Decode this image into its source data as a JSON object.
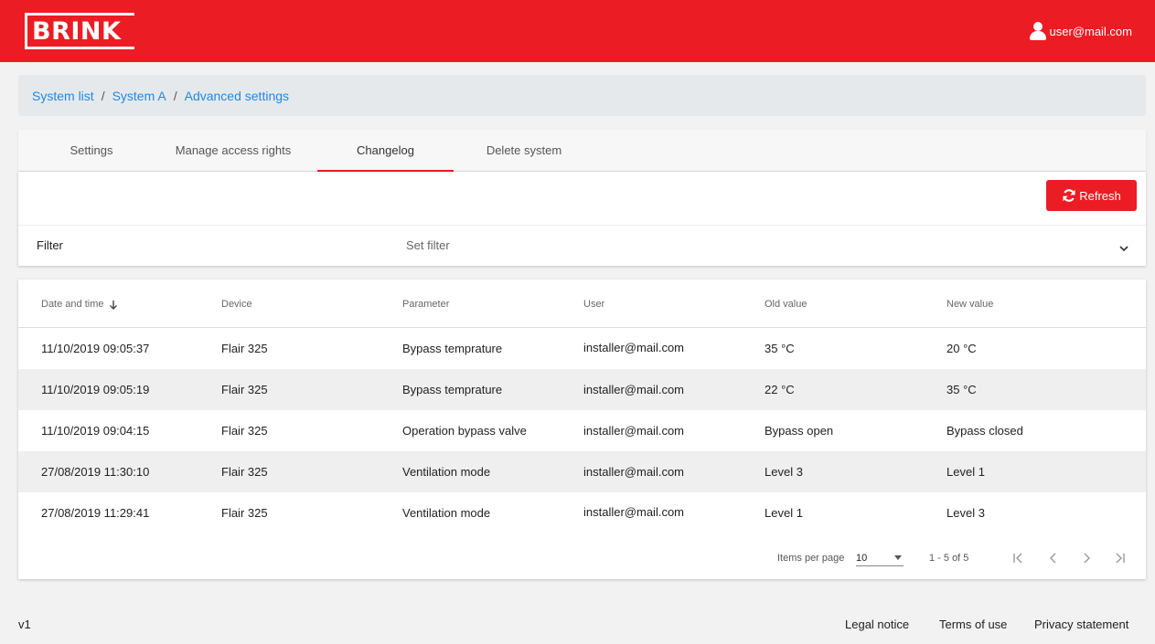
{
  "header": {
    "logo_text": "BRINK",
    "user_email": "user@mail.com",
    "brand_color": "#ec1c24",
    "icons": {
      "user": "user-icon"
    }
  },
  "breadcrumb": {
    "items": [
      "System list",
      "System A",
      "Advanced settings"
    ],
    "separator": "/"
  },
  "tabs": {
    "items": [
      "Settings",
      "Manage access rights",
      "Changelog",
      "Delete system"
    ],
    "active": "Changelog"
  },
  "toolbar": {
    "refresh_label": "Refresh",
    "icons": {
      "refresh": "refresh-icon"
    }
  },
  "filter": {
    "label": "Filter",
    "placeholder": "Set filter",
    "icons": {
      "expand": "chevron-down-icon"
    }
  },
  "table": {
    "columns": [
      "Date and time",
      "Device",
      "Parameter",
      "User",
      "Old value",
      "New value"
    ],
    "sort_column": "Date and time",
    "sort_direction": "descending",
    "rows": [
      [
        "11/10/2019 09:05:37",
        "Flair 325",
        "Bypass temprature",
        "installer@mail.com",
        "35 °C",
        "20 °C"
      ],
      [
        "11/10/2019 09:05:19",
        "Flair 325",
        "Bypass temprature",
        "installer@mail.com",
        "22 °C",
        "35 °C"
      ],
      [
        "11/10/2019 09:04:15",
        "Flair 325",
        "Operation bypass valve",
        "installer@mail.com",
        "Bypass open",
        "Bypass closed"
      ],
      [
        "27/08/2019 11:30:10",
        "Flair 325",
        "Ventilation mode",
        "installer@mail.com",
        "Level 3",
        "Level 1"
      ],
      [
        "27/08/2019 11:29:41",
        "Flair 325",
        "Ventilation mode",
        "installer@mail.com",
        "Level 1",
        "Level 3"
      ]
    ]
  },
  "pagination": {
    "items_per_page_label": "Items per page",
    "items_per_page_value": "10",
    "range": "1 - 5 of 5",
    "icons": {
      "first": "first-page-icon",
      "prev": "previous-page-icon",
      "next": "next-page-icon",
      "last": "last-page-icon"
    }
  },
  "footer": {
    "version": "v1",
    "links": [
      "Legal notice",
      "Terms of use",
      "Privacy statement"
    ]
  }
}
